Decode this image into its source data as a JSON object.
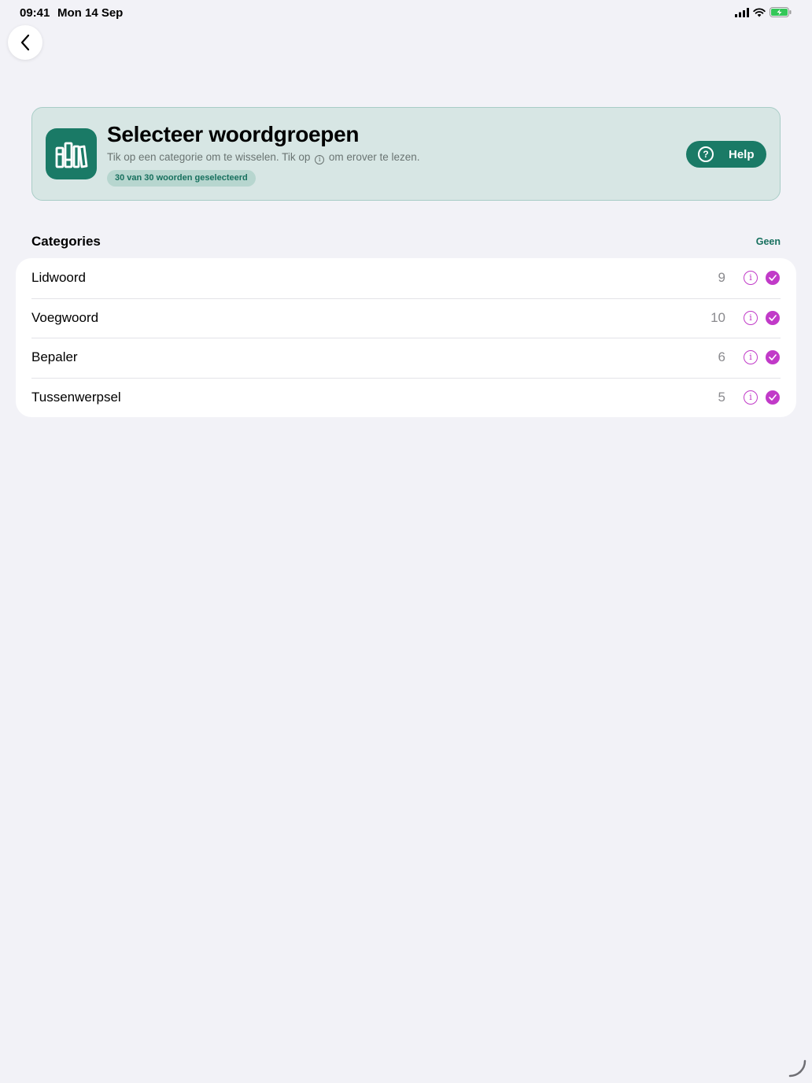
{
  "status_bar": {
    "time": "09:41",
    "date": "Mon 14 Sep",
    "icons": [
      "cellular-signal-icon",
      "wifi-icon",
      "battery-charging-icon"
    ]
  },
  "nav": {
    "back_icon": "chevron-left-icon"
  },
  "header": {
    "title": "Selecteer woordgroepen",
    "subtitle_before": "Tik op een categorie om te wisselen. Tik op",
    "subtitle_info_glyph": "i",
    "subtitle_after": "om erover te lezen.",
    "badge": "30 van 30 woorden geselecteerd",
    "help_label": "Help",
    "help_icon_glyph": "?",
    "app_icon": "books-icon"
  },
  "section": {
    "title": "Categories",
    "action": "Geen"
  },
  "categories": [
    {
      "name": "Lidwoord",
      "count": "9",
      "selected": true
    },
    {
      "name": "Voegwoord",
      "count": "10",
      "selected": true
    },
    {
      "name": "Bepaler",
      "count": "6",
      "selected": true
    },
    {
      "name": "Tussenwerpsel",
      "count": "5",
      "selected": true
    }
  ],
  "colors": {
    "accent": "#1a7a66",
    "selection": "#c13ac8",
    "background": "#f2f2f7",
    "header_bg": "#d7e6e4"
  }
}
